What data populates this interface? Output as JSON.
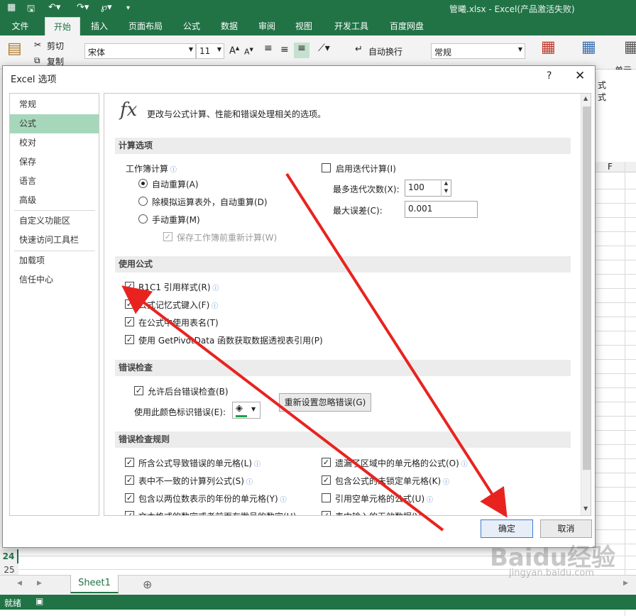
{
  "excel": {
    "window_title": "管曦.xlsx - Excel(产品激活失败)",
    "tabs": [
      "文件",
      "开始",
      "插入",
      "页面布局",
      "公式",
      "数据",
      "审阅",
      "视图",
      "开发工具",
      "百度网盘"
    ],
    "ribbon": {
      "cut": "剪切",
      "copy": "复制",
      "font_name": "宋体",
      "font_size": "11",
      "wrap_text": "自动换行",
      "number_format": "常规",
      "cell_style_partial": "单元格",
      "right_partial_1": "式",
      "right_partial_2": "式"
    },
    "column_header_f": "F",
    "row_numbers": [
      "24",
      "25"
    ],
    "sheet_tab": "Sheet1",
    "status": "就绪",
    "accent": "#217346"
  },
  "dialog": {
    "title": "Excel 选项",
    "help": "?",
    "close": "✕",
    "nav": [
      "常规",
      "公式",
      "校对",
      "保存",
      "语言",
      "高级",
      "自定义功能区",
      "快速访问工具栏",
      "加载项",
      "信任中心"
    ],
    "selected_nav": "公式",
    "header_text": "更改与公式计算、性能和错误处理相关的选项。",
    "sections": {
      "calc": {
        "title": "计算选项",
        "workbook_calc_label": "工作簿计算",
        "auto": "自动重算(A)",
        "auto_except": "除模拟运算表外，自动重算(D)",
        "manual": "手动重算(M)",
        "recalc_before_save": "保存工作簿前重新计算(W)",
        "iterative": "启用迭代计算(I)",
        "max_iter_label": "最多迭代次数(X):",
        "max_iter_value": "100",
        "max_change_label": "最大误差(C):",
        "max_change_value": "0.001"
      },
      "formulas": {
        "title": "使用公式",
        "r1c1": "R1C1 引用样式(R)",
        "autocomplete": "公式记忆式键入(F)",
        "table_names": "在公式中使用表名(T)",
        "getpivotdata": "使用 GetPivotData 函数获取数据透视表引用(P)"
      },
      "errors": {
        "title": "错误检查",
        "background_check": "允许后台错误检查(B)",
        "color_label": "使用此颜色标识错误(E):",
        "reset_button": "重新设置忽略错误(G)"
      },
      "rules": {
        "title": "错误检查规则",
        "left": [
          "所含公式导致错误的单元格(L)",
          "表中不一致的计算列公式(S)",
          "包含以两位数表示的年份的单元格(Y)",
          "文本格式的数字或者前面有撇号的数字(H)"
        ],
        "right": [
          "遗漏了区域中的单元格的公式(O)",
          "包含公式的未锁定单元格(K)",
          "引用空单元格的公式(U)",
          "表中输入的无效数据(V)"
        ]
      }
    },
    "ok": "确定",
    "cancel": "取消"
  },
  "watermark": {
    "main": "Baidu经验",
    "sub": "jingyan.baidu.com"
  }
}
